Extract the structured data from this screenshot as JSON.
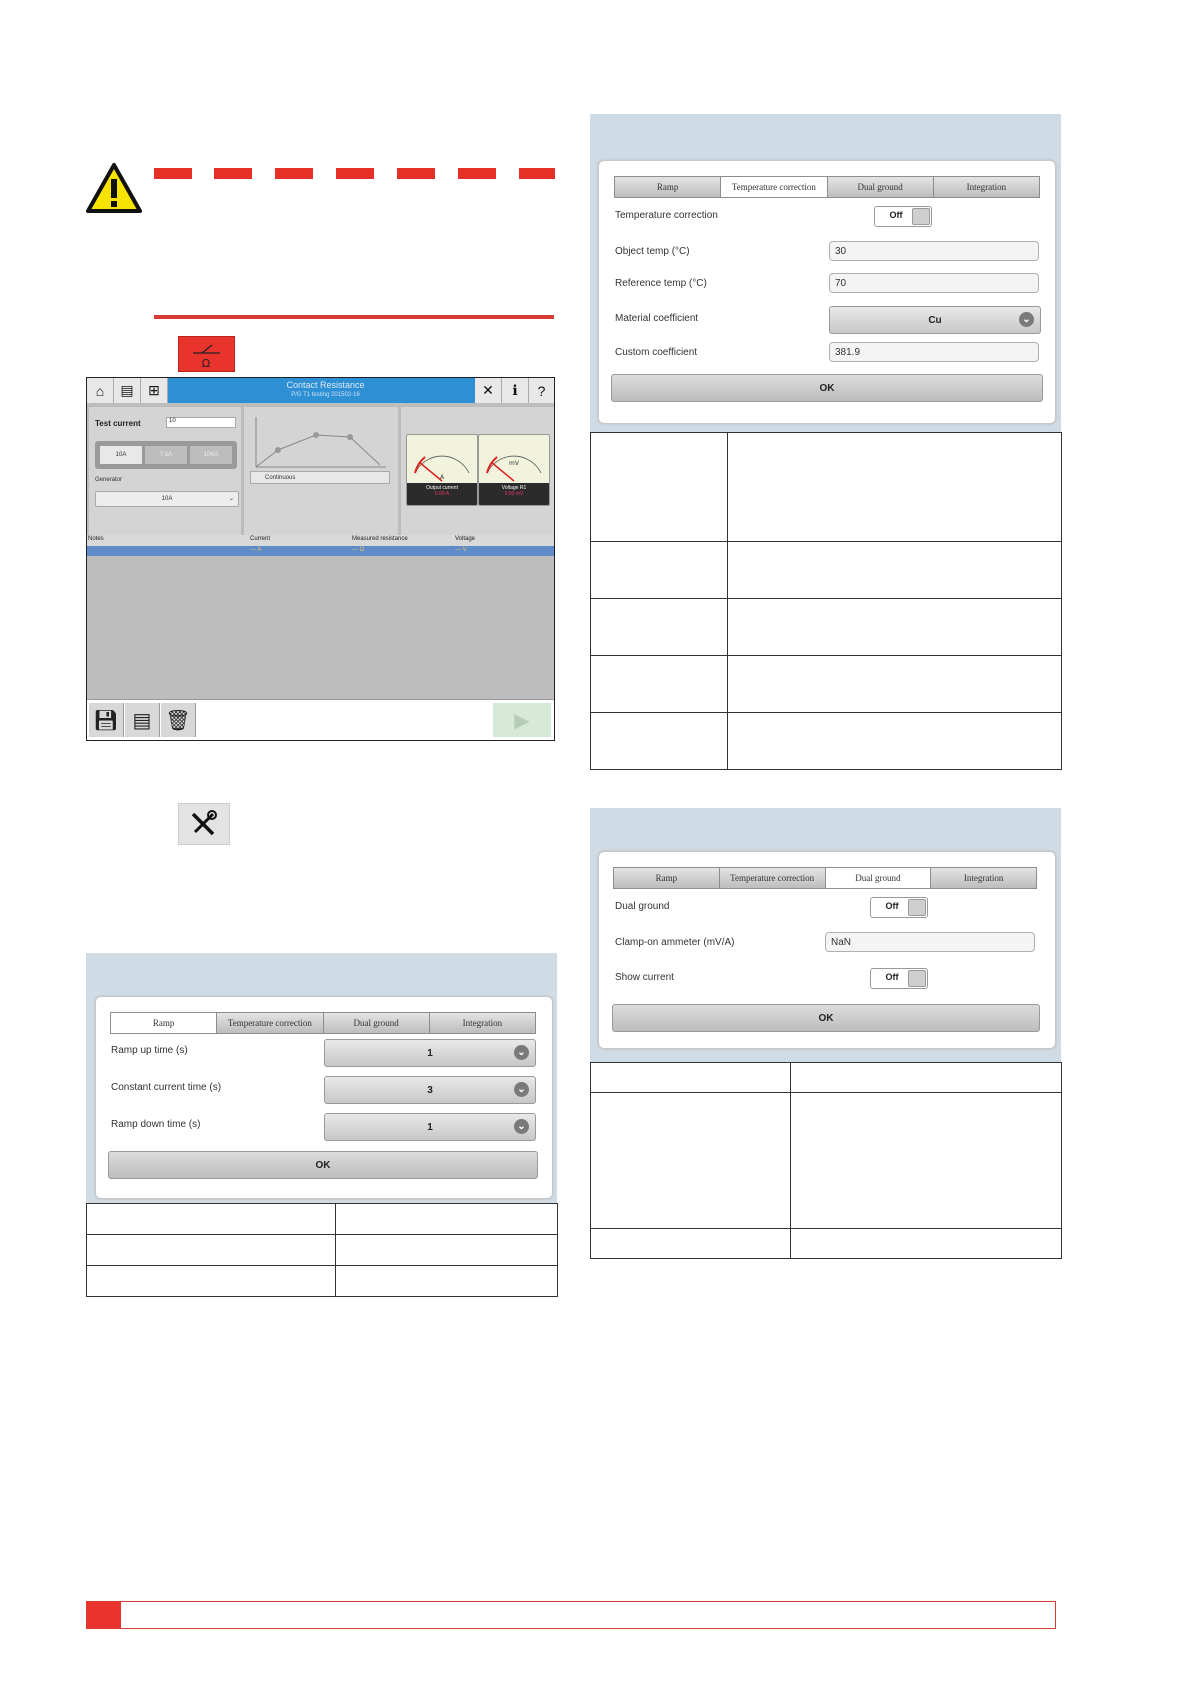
{
  "colors": {
    "accent_red": "#e53027",
    "dialog_bg": "#cfdbe5",
    "app_topbar": "#2d8fd4"
  },
  "icons": {
    "warning": "warning-triangle-icon",
    "cr_test": "contact-resistance-icon",
    "tools": "tools-icon"
  },
  "app": {
    "title": "Contact Resistance",
    "subtitle": "P/G T1 testing 201502-16",
    "test_current_label": "Test current",
    "test_current_value": "10",
    "current_buttons": [
      "10A",
      "7.5A",
      "10KA"
    ],
    "generator_label": "Generator",
    "generator_value": "10A",
    "continuous_label": "Continuous",
    "meter1": {
      "unit": "A",
      "label": "Output current",
      "value": "0.00 A"
    },
    "meter2": {
      "unit": "mV",
      "label": "Voltage R1",
      "value": "0.00 mV"
    },
    "columns": [
      "Notes",
      "Current",
      "Measured resistance",
      "Voltage"
    ],
    "row": [
      "",
      "— A",
      "— Ω",
      "— V"
    ]
  },
  "ramp_dialog": {
    "tabs": [
      "Ramp",
      "Temperature correction",
      "Dual ground",
      "Integration"
    ],
    "active_tab": 0,
    "rows": [
      {
        "label": "Ramp up time (s)",
        "value": "1"
      },
      {
        "label": "Constant current time (s)",
        "value": "3"
      },
      {
        "label": "Ramp down time (s)",
        "value": "1"
      }
    ],
    "ok_label": "OK"
  },
  "temp_dialog": {
    "tabs": [
      "Ramp",
      "Temperature correction",
      "Dual ground",
      "Integration"
    ],
    "active_tab": 1,
    "temperature_correction_label": "Temperature correction",
    "temperature_correction_value": "Off",
    "object_temp_label": "Object temp (°C)",
    "object_temp_value": "30",
    "reference_temp_label": "Reference temp (°C)",
    "reference_temp_value": "70",
    "material_coefficient_label": "Material coefficient",
    "material_coefficient_value": "Cu",
    "custom_coefficient_label": "Custom coefficient",
    "custom_coefficient_value": "381.9",
    "ok_label": "OK"
  },
  "dual_dialog": {
    "tabs": [
      "Ramp",
      "Temperature correction",
      "Dual ground",
      "Integration"
    ],
    "active_tab": 2,
    "dual_ground_label": "Dual ground",
    "dual_ground_value": "Off",
    "clamp_label": "Clamp-on ammeter (mV/A)",
    "clamp_value": "NaN",
    "show_current_label": "Show current",
    "show_current_value": "Off",
    "ok_label": "OK"
  }
}
